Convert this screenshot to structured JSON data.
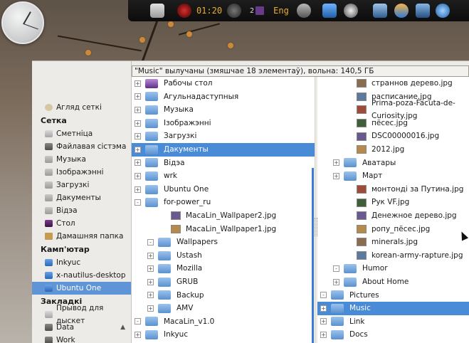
{
  "panel": {
    "timer": "01:20",
    "workspace": "2",
    "keyboard_layout": "Eng"
  },
  "window": {
    "status_text": "\"Music\" вылучаны (змяшчае 18 элементаў), вольна: 140,5 ГБ"
  },
  "sidebar": {
    "headers": {
      "network": "Сетка",
      "computer": "Камп'ютар",
      "bookmarks": "Закладкі"
    },
    "network_items": [
      {
        "label": "Агляд сеткі",
        "icon": "network-icon"
      }
    ],
    "computer_items": [
      {
        "label": "Сметніца",
        "icon": "trash-icon"
      },
      {
        "label": "Файлавая сістэма",
        "icon": "filesystem-icon"
      },
      {
        "label": "Музыка",
        "icon": "music-folder-icon"
      },
      {
        "label": "Ізображэнні",
        "icon": "pictures-folder-icon"
      },
      {
        "label": "Загрузкі",
        "icon": "downloads-folder-icon"
      },
      {
        "label": "Дакументы",
        "icon": "documents-folder-icon"
      },
      {
        "label": "Відэа",
        "icon": "videos-folder-icon"
      },
      {
        "label": "Стол",
        "icon": "desktop-icon"
      },
      {
        "label": "Дамашняя папка",
        "icon": "home-folder-icon"
      }
    ],
    "bookmark_items": [
      {
        "label": "Inkyuc",
        "icon": "folder-icon"
      },
      {
        "label": "x-nautilus-desktop",
        "icon": "folder-icon"
      },
      {
        "label": "Ubuntu One",
        "icon": "folder-icon",
        "selected": true
      }
    ],
    "device_items": [
      {
        "label": "Прывод для дыскет",
        "icon": "floppy-icon"
      },
      {
        "label": "Data",
        "icon": "disk-icon",
        "eject": "▲"
      },
      {
        "label": "Work",
        "icon": "disk-icon"
      }
    ]
  },
  "column1": [
    {
      "expander": "+",
      "icon": "picture-folder-icon",
      "label": "Рабочы стол"
    },
    {
      "expander": "+",
      "icon": "folder-icon",
      "label": "Агульнадаступныя"
    },
    {
      "expander": "+",
      "icon": "folder-icon",
      "label": "Музыка"
    },
    {
      "expander": "+",
      "icon": "folder-icon",
      "label": "Ізображэнні"
    },
    {
      "expander": "+",
      "icon": "folder-icon",
      "label": "Загрузкі"
    },
    {
      "expander": "+",
      "icon": "folder-icon",
      "label": "Дакументы",
      "selected": true
    },
    {
      "expander": "+",
      "icon": "folder-icon",
      "label": "Відэа"
    },
    {
      "expander": "+",
      "icon": "folder-icon",
      "label": "wrk"
    },
    {
      "expander": "+",
      "icon": "folder-icon",
      "label": "Ubuntu One"
    },
    {
      "expander": "-",
      "icon": "folder-icon",
      "label": "for-power_ru"
    },
    {
      "expander": "",
      "icon": "image-thumb-icon",
      "label": "MacaLin_Wallpaper2.jpg",
      "indent": 2
    },
    {
      "expander": "",
      "icon": "image-thumb-icon",
      "label": "MacaLin_Wallpaper1.jpg",
      "indent": 2
    },
    {
      "expander": "-",
      "icon": "folder-icon",
      "label": "Wallpapers",
      "indent": 1
    },
    {
      "expander": "+",
      "icon": "folder-icon",
      "label": "Ustash",
      "indent": 1
    },
    {
      "expander": "+",
      "icon": "folder-icon",
      "label": "Mozilla",
      "indent": 1
    },
    {
      "expander": "+",
      "icon": "folder-icon",
      "label": "GRUB",
      "indent": 1
    },
    {
      "expander": "+",
      "icon": "folder-icon",
      "label": "Backup",
      "indent": 1
    },
    {
      "expander": "+",
      "icon": "folder-icon",
      "label": "AMV",
      "indent": 1
    },
    {
      "expander": "-",
      "icon": "folder-icon",
      "label": "MacaLin_v1.0"
    },
    {
      "expander": "+",
      "icon": "folder-icon",
      "label": "Inkyuc"
    }
  ],
  "column2": [
    {
      "expander": "",
      "icon": "image-thumb-icon",
      "label": "страннов дерево.jpg",
      "indent": 2
    },
    {
      "expander": "",
      "icon": "image-thumb-icon",
      "label": "расписание.jpg",
      "indent": 2
    },
    {
      "expander": "",
      "icon": "image-thumb-icon",
      "label": "Prima-poza-Facuta-de-Curiosity.jpg",
      "indent": 2
    },
    {
      "expander": "",
      "icon": "image-thumb-icon",
      "label": "пёсес.jpg",
      "indent": 2
    },
    {
      "expander": "",
      "icon": "image-thumb-icon",
      "label": "DSC00000016.jpg",
      "indent": 2
    },
    {
      "expander": "",
      "icon": "image-thumb-icon",
      "label": "2012.jpg",
      "indent": 2
    },
    {
      "expander": "+",
      "icon": "folder-icon",
      "label": "Аватары",
      "indent": 1
    },
    {
      "expander": "+",
      "icon": "folder-icon",
      "label": "Март",
      "indent": 1
    },
    {
      "expander": "",
      "icon": "image-thumb-icon",
      "label": "монтонді за Путина.jpg",
      "indent": 2
    },
    {
      "expander": "",
      "icon": "image-thumb-icon",
      "label": "Рук VF.jpg",
      "indent": 2
    },
    {
      "expander": "",
      "icon": "image-thumb-icon",
      "label": "Денежное дерево.jpg",
      "indent": 2
    },
    {
      "expander": "",
      "icon": "image-thumb-icon",
      "label": "ропу_пёсес.jpg",
      "indent": 2
    },
    {
      "expander": "",
      "icon": "image-thumb-icon",
      "label": "minerals.jpg",
      "indent": 2
    },
    {
      "expander": "",
      "icon": "image-thumb-icon",
      "label": "korean-army-rapture.jpg",
      "indent": 2
    },
    {
      "expander": "-",
      "icon": "folder-icon",
      "label": "Humor",
      "indent": 1
    },
    {
      "expander": "+",
      "icon": "folder-icon",
      "label": "About Home",
      "indent": 1
    },
    {
      "expander": "-",
      "icon": "folder-icon",
      "label": "Pictures"
    },
    {
      "expander": "+",
      "icon": "folder-icon",
      "label": "Music",
      "selected": true
    },
    {
      "expander": "+",
      "icon": "folder-icon",
      "label": "Link"
    },
    {
      "expander": "+",
      "icon": "folder-icon",
      "label": "Docs"
    }
  ],
  "colors": {
    "selection": "#4a8bd8",
    "sidebar_selection": "#5f94d6",
    "folder": "#7aa8de"
  }
}
